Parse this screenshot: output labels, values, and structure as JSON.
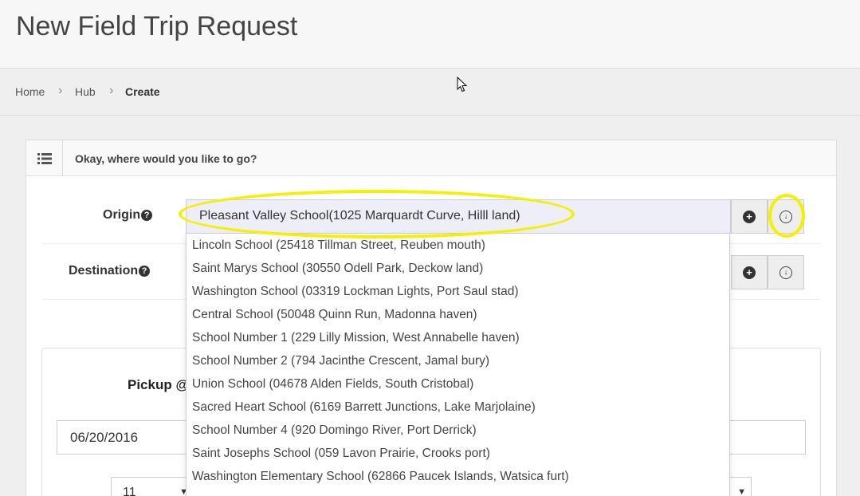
{
  "page": {
    "title": "New Field Trip Request"
  },
  "breadcrumb": {
    "items": [
      "Home",
      "Hub",
      "Create"
    ],
    "separator": "›"
  },
  "panel": {
    "title": "Okay, where would you like to go?",
    "icon": "list-icon"
  },
  "origin": {
    "label": "Origin",
    "value": "Pleasant Valley School(1025 Marquardt Curve, Hilll land)",
    "add_icon": "plus-circle-icon",
    "download_icon": "arrow-down-circle-icon"
  },
  "destination": {
    "label": "Destination",
    "add_icon": "plus-circle-icon",
    "download_icon": "arrow-down-circle-icon"
  },
  "help_glyph": "?",
  "pickup": {
    "label": "Pickup @",
    "date": "06/20/2016",
    "hour": "11"
  },
  "dropdown": {
    "options": [
      "Lincoln School (25418 Tillman Street, Reuben mouth)",
      "Saint Marys School (30550 Odell Park, Deckow land)",
      "Washington School (03319 Lockman Lights, Port Saul stad)",
      "Central School (50048 Quinn Run, Madonna haven)",
      "School Number 1 (229 Lilly Mission, West Annabelle haven)",
      "School Number 2 (794 Jacinthe Crescent, Jamal bury)",
      "Union School (04678 Alden Fields, South Cristobal)",
      "Sacred Heart School (6169 Barrett Junctions, Lake Marjolaine)",
      "School Number 4 (920 Domingo River, Port Derrick)",
      "Saint Josephs School (059 Lavon Prairie, Crooks port)",
      "Washington Elementary School (62866 Paucek Islands, Watsica furt)"
    ]
  },
  "annotation_color": "#f4f000"
}
